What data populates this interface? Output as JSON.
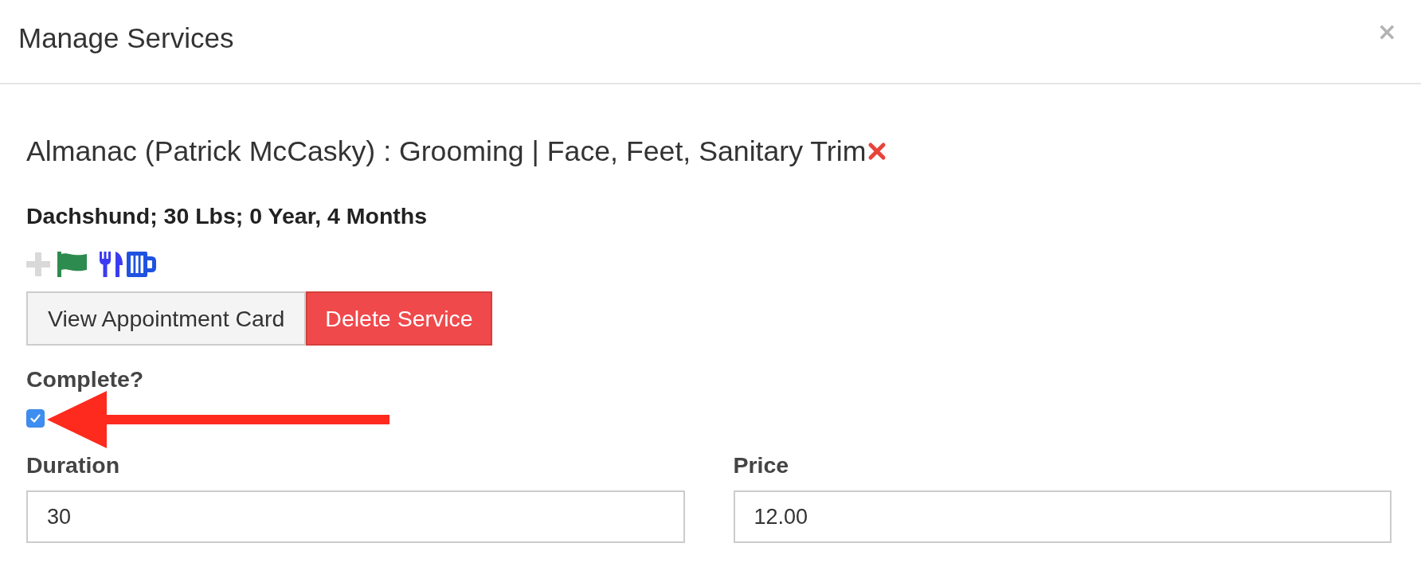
{
  "dialog": {
    "title": "Manage Services",
    "close_button": "×"
  },
  "service": {
    "title": "Almanac (Patrick McCasky) : Grooming | Face, Feet, Sanitary Trim",
    "details": "Dachshund; 30 Lbs; 0 Year, 4 Months"
  },
  "buttons": [
    {
      "label": "View Appointment Card",
      "kind": "default"
    },
    {
      "label": "Delete Service",
      "kind": "danger"
    }
  ],
  "complete": {
    "label": "Complete?",
    "checked": true
  },
  "fields": [
    {
      "label": "Duration",
      "value": "30"
    },
    {
      "label": "Price",
      "value": "12.00"
    }
  ]
}
